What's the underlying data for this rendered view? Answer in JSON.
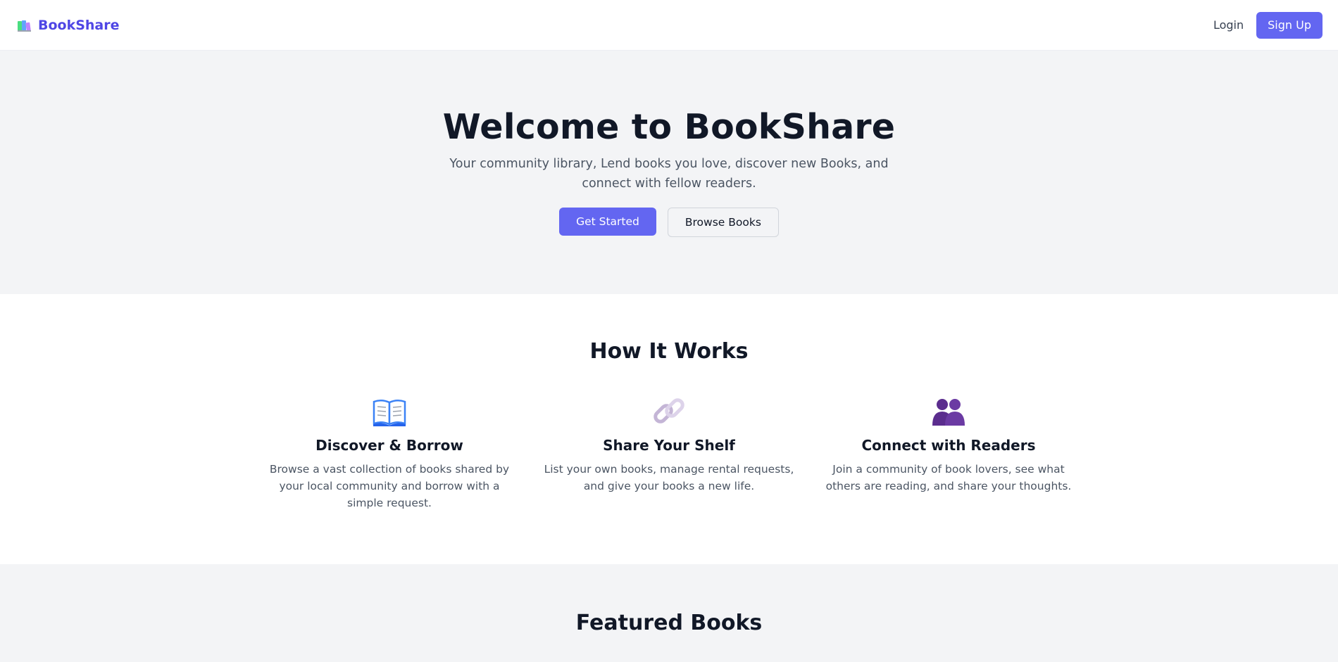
{
  "header": {
    "brand": "BookShare",
    "login_label": "Login",
    "signup_label": "Sign Up"
  },
  "hero": {
    "title": "Welcome to BookShare",
    "subtitle": "Your community library, Lend books you love, discover new Books, and connect with fellow readers.",
    "primary_button": "Get Started",
    "secondary_button": "Browse Books"
  },
  "how_it_works": {
    "title": "How It Works",
    "features": [
      {
        "icon": "open-book-icon",
        "title": "Discover & Borrow",
        "description": "Browse a vast collection of books shared by your local community and borrow with a simple request."
      },
      {
        "icon": "link-icon",
        "title": "Share Your Shelf",
        "description": "List your own books, manage rental requests, and give your books a new life."
      },
      {
        "icon": "people-icon",
        "title": "Connect with Readers",
        "description": "Join a community of book lovers, see what others are reading, and share your thoughts."
      }
    ]
  },
  "featured": {
    "title": "Featured Books"
  },
  "colors": {
    "accent": "#6366f1",
    "brand_text": "#4f46e5",
    "section_gray": "#f3f4f6"
  }
}
